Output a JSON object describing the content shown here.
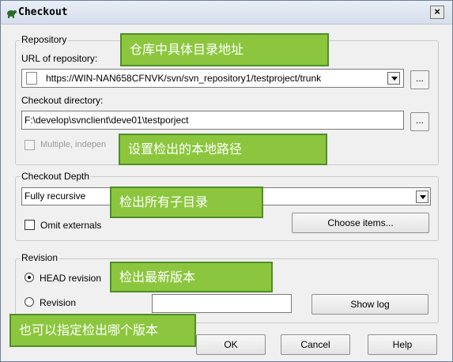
{
  "window": {
    "title": "Checkout",
    "close_label": "×"
  },
  "repository": {
    "group_label": "Repository",
    "url_label": "URL of repository:",
    "url_value": "https://WIN-NAN658CFNVK/svn/svn_repository1/testproject/trunk",
    "browse_label": "...",
    "dir_label": "Checkout directory:",
    "dir_value": "F:\\develop\\svnclient\\deve01\\testporject",
    "multiple_label": "Multiple, indepen"
  },
  "depth": {
    "group_label": "Checkout Depth",
    "selected": "Fully recursive",
    "omit_label": "Omit externals",
    "choose_label": "Choose items..."
  },
  "revision": {
    "group_label": "Revision",
    "head_label": "HEAD revision",
    "revision_label": "Revision",
    "revision_value": "",
    "showlog_label": "Show log"
  },
  "buttons": {
    "ok": "OK",
    "cancel": "Cancel",
    "help": "Help"
  },
  "annotations": {
    "repo": "仓库中具体目录地址",
    "local": "设置检出的本地路径",
    "depth": "检出所有子目录",
    "head": "检出最新版本",
    "specific": "也可以指定检出哪个版本"
  },
  "colors": {
    "note_fill": "#8cc63e",
    "note_border": "#4e8f26",
    "title_gradient": "#d6dfec"
  }
}
